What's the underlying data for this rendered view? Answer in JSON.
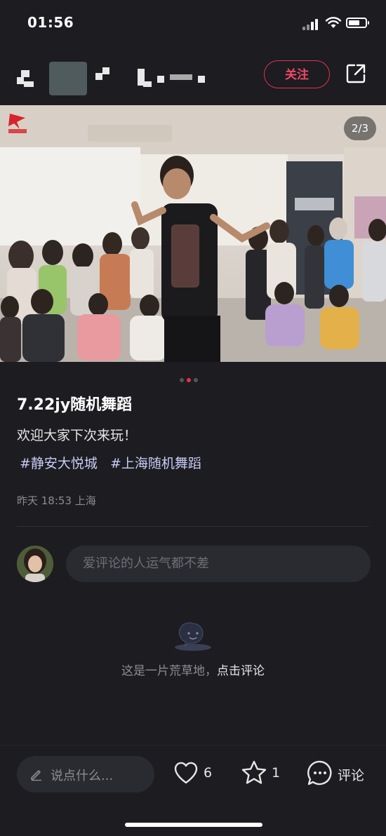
{
  "status_bar": {
    "time": "01:56"
  },
  "header": {
    "follow_label": "关注"
  },
  "post": {
    "image_counter": "2/3",
    "title": "7.22jy随机舞蹈",
    "description": "欢迎大家下次来玩！",
    "tags": [
      "#静安大悦城",
      "#上海随机舞蹈"
    ],
    "meta": "昨天 18:53 上海",
    "image_dots": {
      "count": 3,
      "active_index": 1
    }
  },
  "comments": {
    "placeholder": "爱评论的人运气都不差",
    "empty_text": "这是一片荒草地，",
    "empty_link": "点击评论"
  },
  "bottom_bar": {
    "say_placeholder": "说点什么...",
    "like_count": "6",
    "collect_count": "1",
    "comment_label": "评论"
  },
  "colors": {
    "accent": "#e8314f",
    "background": "#1c1c21"
  }
}
